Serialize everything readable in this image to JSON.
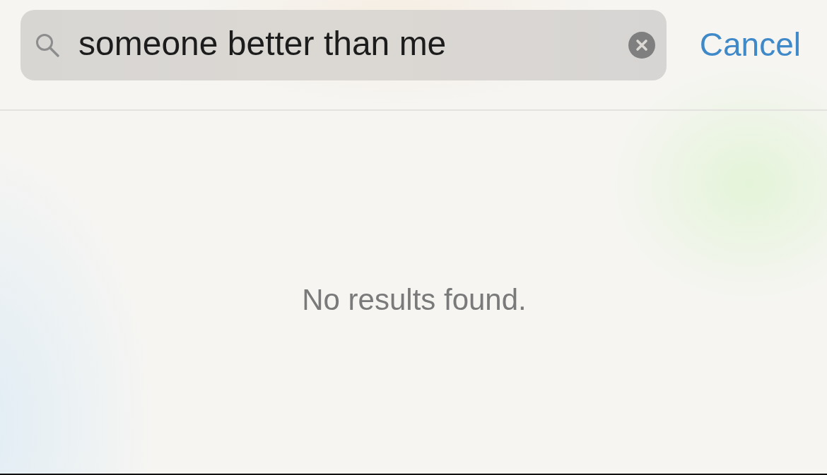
{
  "search": {
    "value": "someone better than me",
    "cancel": "Cancel"
  },
  "results": {
    "message": "No results found."
  }
}
